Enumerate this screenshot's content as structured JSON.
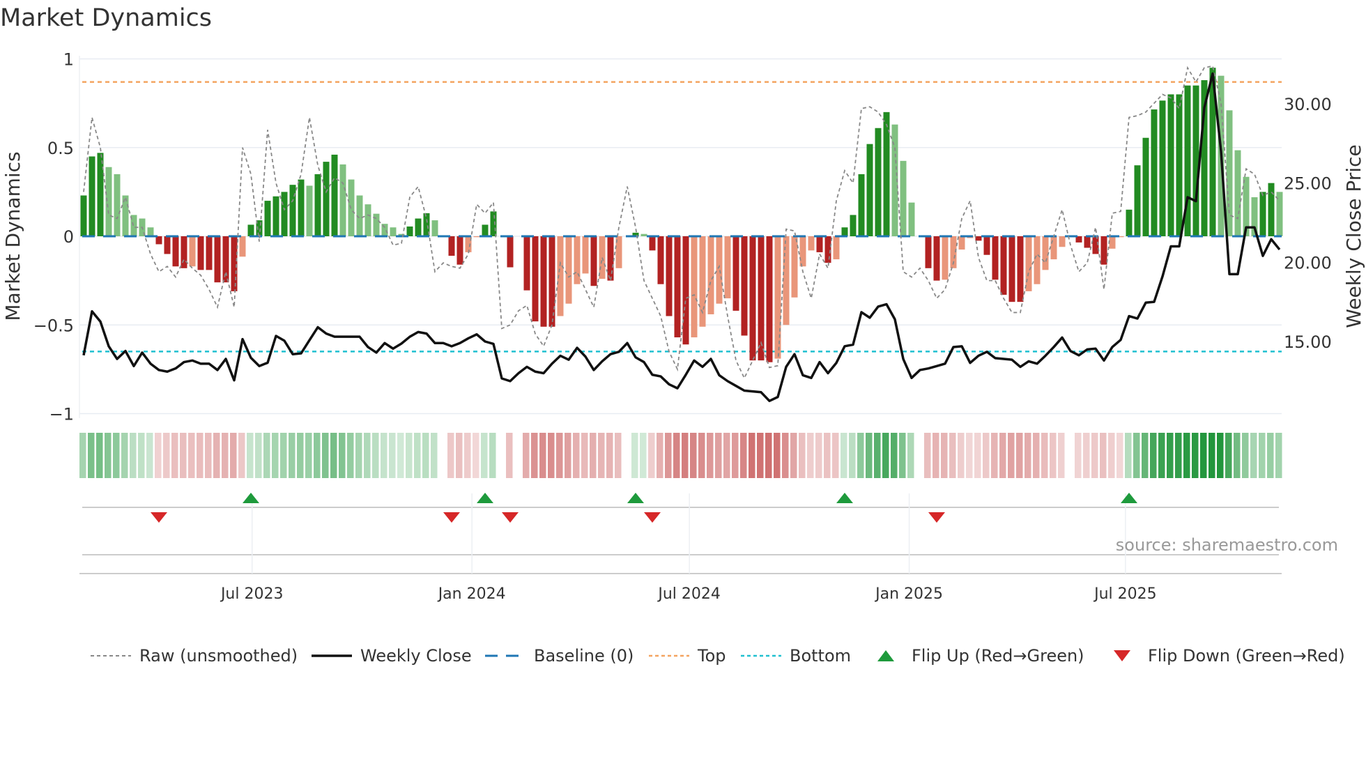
{
  "title": "Market Dynamics",
  "source": "source: sharemaestro.com",
  "colors": {
    "up_strong": "#228b22",
    "up_weak": "#80c080",
    "down_strong": "#b22222",
    "down_weak": "#e9967a",
    "raw": "#888888",
    "close": "#111111",
    "baseline": "#1f77b4",
    "top": "#f4a460",
    "bottom": "#20c0d0",
    "flip_up": "#1e9a3c",
    "flip_down": "#d62728"
  },
  "chart_data": {
    "type": "bar+line",
    "title": "Market Dynamics",
    "ylabel": "Market Dynamics",
    "ylabel_right": "Weekly Close Price",
    "ylim": [
      -1,
      1
    ],
    "ylim_right": [
      8.5,
      33.5
    ],
    "yticks": [
      {
        "v": 1,
        "label": "1"
      },
      {
        "v": 0.5,
        "label": "0.5"
      },
      {
        "v": 0,
        "label": "0"
      },
      {
        "v": -0.5,
        "label": "−0.5"
      },
      {
        "v": -1,
        "label": "−1"
      }
    ],
    "yticks_right": [
      {
        "v": 30,
        "label": "30.00"
      },
      {
        "v": 25,
        "label": "25.00"
      },
      {
        "v": 20,
        "label": "20.00"
      },
      {
        "v": 15,
        "label": "15.00"
      }
    ],
    "x_start": "2023-02-10",
    "x_frequency": "weekly",
    "xticks": [
      {
        "date": "2023-07-01",
        "label": "Jul 2023"
      },
      {
        "date": "2024-01-01",
        "label": "Jan 2024"
      },
      {
        "date": "2024-07-01",
        "label": "Jul 2024"
      },
      {
        "date": "2025-01-01",
        "label": "Jan 2025"
      },
      {
        "date": "2025-07-01",
        "label": "Jul 2025"
      }
    ],
    "top_level": 0.87,
    "bottom_level": -0.65,
    "baseline": 0,
    "dynamics": [
      0.23,
      0.45,
      0.47,
      0.39,
      0.35,
      0.23,
      0.12,
      0.1,
      0.05,
      -0.045,
      -0.1,
      -0.17,
      -0.18,
      -0.17,
      -0.19,
      -0.19,
      -0.26,
      -0.26,
      -0.31,
      -0.115,
      0.065,
      0.09,
      0.2,
      0.225,
      0.25,
      0.29,
      0.32,
      0.285,
      0.35,
      0.42,
      0.46,
      0.405,
      0.32,
      0.23,
      0.18,
      0.127,
      0.07,
      0.05,
      0.013,
      0.055,
      0.1,
      0.13,
      0.09,
      0,
      -0.11,
      -0.16,
      -0.09,
      -0.005,
      0.065,
      0.14,
      0,
      -0.175,
      0,
      -0.305,
      -0.48,
      -0.51,
      -0.51,
      -0.45,
      -0.38,
      -0.27,
      -0.21,
      -0.28,
      -0.24,
      -0.25,
      -0.18,
      0,
      0.02,
      0.013,
      -0.08,
      -0.27,
      -0.45,
      -0.57,
      -0.61,
      -0.57,
      -0.51,
      -0.44,
      -0.38,
      -0.35,
      -0.42,
      -0.56,
      -0.7,
      -0.7,
      -0.71,
      -0.69,
      -0.5,
      -0.345,
      -0.17,
      -0.08,
      -0.09,
      -0.15,
      -0.13,
      0.05,
      0.12,
      0.35,
      0.52,
      0.61,
      0.7,
      0.63,
      0.425,
      0.19,
      0,
      -0.18,
      -0.25,
      -0.245,
      -0.18,
      -0.075,
      -0.01,
      -0.025,
      -0.105,
      -0.245,
      -0.33,
      -0.37,
      -0.37,
      -0.31,
      -0.27,
      -0.19,
      -0.13,
      -0.06,
      0,
      -0.035,
      -0.065,
      -0.1,
      -0.16,
      -0.07,
      -0.005,
      0.15,
      0.4,
      0.555,
      0.715,
      0.765,
      0.8,
      0.8,
      0.85,
      0.85,
      0.88,
      0.95,
      0.905,
      0.71,
      0.485,
      0.335,
      0.22,
      0.25,
      0.3,
      0.25
    ],
    "raw": [
      0.25,
      0.67,
      0.5,
      0.12,
      0.1,
      0.22,
      0.05,
      0.05,
      -0.1,
      -0.2,
      -0.17,
      -0.23,
      -0.13,
      -0.18,
      -0.22,
      -0.3,
      -0.4,
      -0.2,
      -0.4,
      0.5,
      0.35,
      -0.03,
      0.6,
      0.3,
      0.15,
      0.2,
      0.35,
      0.67,
      0.4,
      0.25,
      0.33,
      0.3,
      0.15,
      0.1,
      0.12,
      0.1,
      0.05,
      -0.05,
      -0.04,
      0.22,
      0.28,
      0.1,
      -0.2,
      -0.15,
      -0.17,
      -0.18,
      -0.1,
      0.18,
      0.13,
      0.19,
      -0.52,
      -0.5,
      -0.42,
      -0.39,
      -0.55,
      -0.62,
      -0.5,
      -0.15,
      -0.23,
      -0.2,
      -0.3,
      -0.4,
      -0.12,
      -0.25,
      0.05,
      0.28,
      0.05,
      -0.25,
      -0.35,
      -0.45,
      -0.65,
      -0.75,
      -0.35,
      -0.33,
      -0.43,
      -0.25,
      -0.17,
      -0.45,
      -0.7,
      -0.8,
      -0.7,
      -0.6,
      -0.74,
      -0.73,
      0.04,
      0.03,
      -0.2,
      -0.35,
      -0.1,
      -0.18,
      0.2,
      0.37,
      0.3,
      0.72,
      0.73,
      0.7,
      0.63,
      0.5,
      -0.2,
      -0.23,
      -0.18,
      -0.25,
      -0.35,
      -0.3,
      -0.15,
      0.1,
      0.2,
      -0.12,
      -0.25,
      -0.25,
      -0.35,
      -0.43,
      -0.43,
      -0.2,
      -0.1,
      -0.15,
      0.0,
      0.15,
      -0.05,
      -0.2,
      -0.15,
      0.05,
      -0.3,
      0.13,
      0.14,
      0.67,
      0.68,
      0.7,
      0.75,
      0.8,
      0.78,
      0.72,
      0.95,
      0.87,
      0.95,
      0.96,
      0.75,
      0.12,
      0.1,
      0.38,
      0.35,
      0.23,
      0.25,
      0.2
    ],
    "close": [
      14.13,
      16.9,
      16.26,
      14.7,
      13.9,
      14.4,
      13.45,
      14.3,
      13.6,
      13.2,
      13.1,
      13.3,
      13.7,
      13.8,
      13.6,
      13.6,
      13.2,
      13.9,
      12.55,
      15.15,
      13.97,
      13.45,
      13.66,
      15.35,
      15.05,
      14.2,
      14.25,
      15.08,
      15.9,
      15.5,
      15.3,
      15.3,
      15.3,
      15.3,
      14.65,
      14.3,
      14.9,
      14.55,
      14.87,
      15.3,
      15.6,
      15.5,
      14.9,
      14.9,
      14.7,
      14.9,
      15.2,
      15.45,
      15.0,
      14.85,
      12.67,
      12.5,
      13.0,
      13.4,
      13.1,
      13.0,
      13.6,
      14.1,
      13.85,
      14.6,
      14.05,
      13.2,
      13.75,
      14.2,
      14.35,
      14.9,
      14.0,
      13.7,
      12.9,
      12.8,
      12.3,
      12.05,
      12.9,
      13.8,
      13.4,
      13.9,
      12.87,
      12.5,
      12.2,
      11.9,
      11.85,
      11.8,
      11.25,
      11.5,
      13.4,
      14.2,
      12.87,
      12.7,
      13.7,
      13.0,
      13.65,
      14.7,
      14.8,
      16.85,
      16.5,
      17.2,
      17.35,
      16.4,
      13.9,
      12.7,
      13.2,
      13.3,
      13.45,
      13.6,
      14.65,
      14.7,
      13.65,
      14.1,
      14.35,
      13.95,
      13.9,
      13.85,
      13.4,
      13.75,
      13.6,
      14.1,
      14.65,
      15.25,
      14.4,
      14.13,
      14.5,
      14.55,
      13.8,
      14.65,
      15.1,
      16.6,
      16.45,
      17.45,
      17.5,
      19.1,
      21.0,
      21.0,
      24.1,
      23.85,
      29.75,
      31.9,
      27.0,
      19.25,
      19.25,
      22.2,
      22.2,
      20.4,
      21.45,
      20.8
    ],
    "flip_up_week_index": [
      20,
      48,
      66,
      91,
      125
    ],
    "flip_down_week_index": [
      9,
      44,
      51,
      68,
      102
    ],
    "legend": {
      "placement": "bottom",
      "items": [
        "Raw (unsmoothed)",
        "Weekly Close",
        "Baseline (0)",
        "Top",
        "Bottom",
        "Flip Up (Red→Green)",
        "Flip Down (Green→Red)"
      ]
    }
  }
}
